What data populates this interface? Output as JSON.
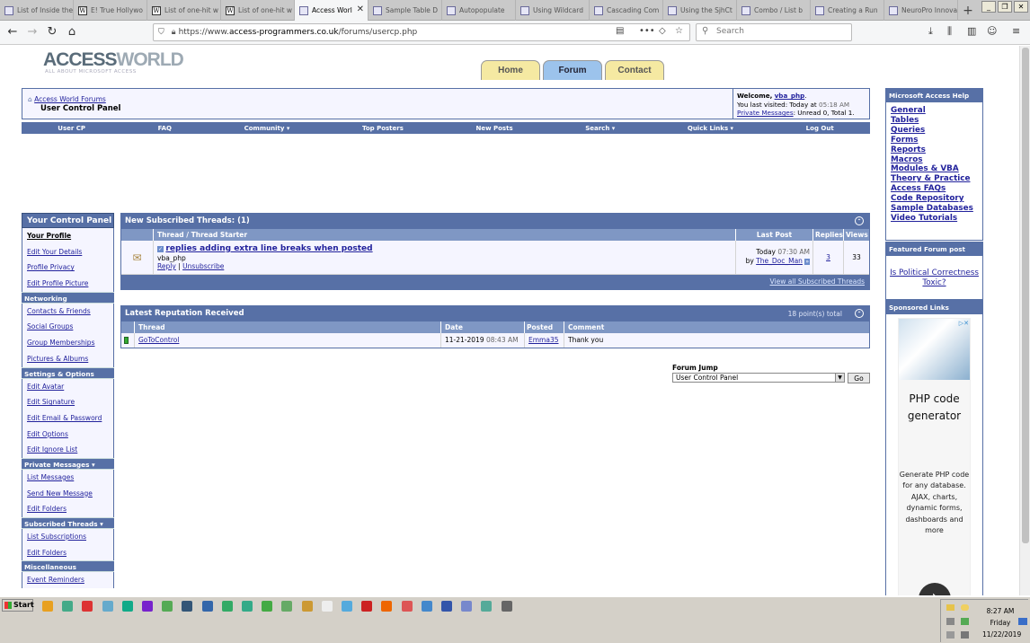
{
  "browser": {
    "tabs": [
      {
        "label": "List of Inside the Act",
        "icon": "page-icon",
        "active": false
      },
      {
        "label": "E! True Hollywo",
        "icon": "wikipedia-icon",
        "active": false
      },
      {
        "label": "List of one-hit w",
        "icon": "wikipedia-icon",
        "active": false
      },
      {
        "label": "List of one-hit w",
        "icon": "wikipedia-icon",
        "active": false
      },
      {
        "label": "Access Worl",
        "icon": "forum-icon",
        "active": true
      },
      {
        "label": "Sample Table D",
        "icon": "forum-icon",
        "active": false
      },
      {
        "label": "Autopopulate",
        "icon": "forum-icon",
        "active": false
      },
      {
        "label": "Using Wildcard",
        "icon": "forum-icon",
        "active": false
      },
      {
        "label": "Cascading Com",
        "icon": "forum-icon",
        "active": false
      },
      {
        "label": "Using the SjhCt",
        "icon": "forum-icon",
        "active": false
      },
      {
        "label": "Combo / List b",
        "icon": "forum-icon",
        "active": false
      },
      {
        "label": "Creating a Run",
        "icon": "forum-icon",
        "active": false
      },
      {
        "label": "NeuroPro Innovat",
        "icon": "page-icon",
        "active": false
      }
    ],
    "url_prefix": "https://www.",
    "url_domain": "access-programmers.co.uk",
    "url_path": "/forums/usercp.php",
    "search_placeholder": "Search"
  },
  "site": {
    "logo_a": "ACCESS",
    "logo_b": "WORLD",
    "logo_sub": "ALL ABOUT MICROSOFT ACCESS",
    "tabs": {
      "home": "Home",
      "forum": "Forum",
      "contact": "Contact"
    }
  },
  "breadcrumb": {
    "root": "Access World Forums",
    "current": "User Control Panel"
  },
  "welcome": {
    "greet": "Welcome,",
    "user": "vba_php",
    "visited": "You last visited: Today at",
    "time": "05:18 AM",
    "pm_link": "Private Messages",
    "pm_text": ": Unread 0, Total 1."
  },
  "topnav": [
    "User CP",
    "FAQ",
    "Community ▾",
    "Top Posters",
    "New Posts",
    "Search ▾",
    "Quick Links ▾",
    "Log Out"
  ],
  "control_panel": {
    "title": "Your Control Panel",
    "sections": [
      {
        "label": "",
        "items": [
          {
            "label": "Your Profile",
            "bold": true
          },
          {
            "label": "Edit Your Details"
          },
          {
            "label": "Profile Privacy"
          },
          {
            "label": "Edit Profile Picture"
          }
        ]
      },
      {
        "label": "Networking",
        "items": [
          {
            "label": "Contacts & Friends"
          },
          {
            "label": "Social Groups"
          },
          {
            "label": "Group Memberships"
          },
          {
            "label": "Pictures & Albums"
          }
        ]
      },
      {
        "label": "Settings & Options",
        "items": [
          {
            "label": "Edit Avatar"
          },
          {
            "label": "Edit Signature"
          },
          {
            "label": "Edit Email & Password"
          },
          {
            "label": "Edit Options"
          },
          {
            "label": "Edit Ignore List"
          }
        ]
      },
      {
        "label": "Private Messages ▾",
        "items": [
          {
            "label": "List Messages"
          },
          {
            "label": "Send New Message"
          },
          {
            "label": "Edit Folders"
          }
        ]
      },
      {
        "label": "Subscribed Threads ▾",
        "items": [
          {
            "label": "List Subscriptions"
          },
          {
            "label": "Edit Folders"
          }
        ]
      },
      {
        "label": "Miscellaneous",
        "items": [
          {
            "label": "Event Reminders"
          }
        ]
      }
    ]
  },
  "subscribed": {
    "title": "New Subscribed Threads",
    "count": "(1)",
    "columns": {
      "thread": "Thread / Thread Starter",
      "last_post": "Last Post",
      "replies": "Replies",
      "views": "Views"
    },
    "rows": [
      {
        "title": "replies adding extra line breaks when posted",
        "starter": "vba_php",
        "reply": "Reply",
        "unsubscribe": "Unsubscribe",
        "last_day": "Today",
        "last_time": "07:30 AM",
        "by": "by",
        "last_user": "The_Doc_Man",
        "replies": "3",
        "views": "33"
      }
    ],
    "footer_link": "View all Subscribed Threads"
  },
  "reputation": {
    "title": "Latest Reputation Received",
    "total": "18 point(s) total",
    "columns": {
      "thread": "Thread",
      "date": "Date",
      "posted_by": "Posted By",
      "comment": "Comment"
    },
    "rows": [
      {
        "thread": "GoToControl",
        "date": "11-21-2019",
        "time": "08:43 AM",
        "posted_by": "Emma35",
        "comment": "Thank you"
      }
    ]
  },
  "forum_jump": {
    "label": "Forum Jump",
    "selected": "User Control Panel",
    "go": "Go"
  },
  "help": {
    "title": "Microsoft Access Help",
    "links": [
      "General",
      "Tables",
      "Queries",
      "Forms",
      "Reports",
      "Macros",
      "Modules & VBA",
      "Theory & Practice",
      "Access FAQs",
      "Code Repository",
      "Sample Databases",
      "Video Tutorials"
    ]
  },
  "featured": {
    "title": "Featured Forum post",
    "link": "Is Political Correctness Toxic?"
  },
  "sponsored": {
    "title": "Sponsored Links",
    "ad_title": "PHP code generator",
    "ad_body": "Generate PHP code for any database. AJAX, charts, dynamic forms, dashboards and more",
    "ad_marker": "▷✕"
  },
  "taskbar": {
    "start": "Start",
    "time": "8:27 AM",
    "day": "Friday",
    "date": "11/22/2019"
  }
}
